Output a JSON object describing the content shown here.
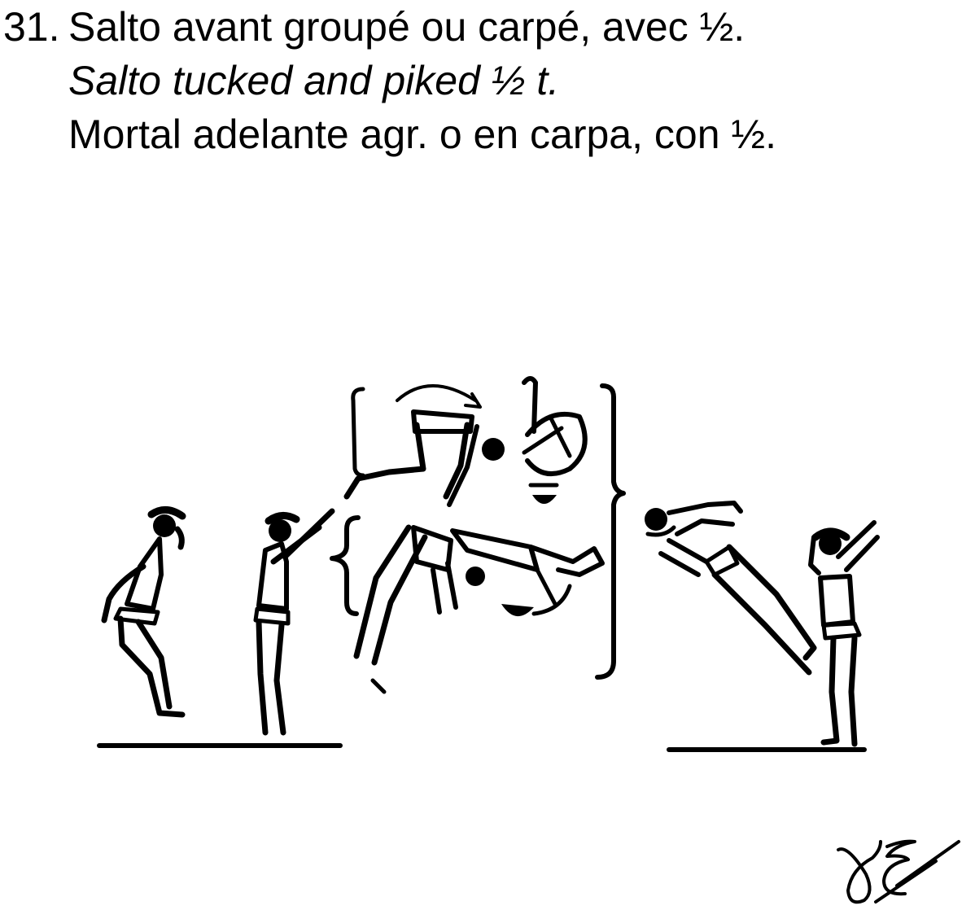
{
  "element": {
    "number": "31.",
    "title_fr": "Salto avant groupé ou carpé, avec ½.",
    "title_en": "Salto tucked and piked ½ t.",
    "title_es": "Mortal adelante agr. o en carpa, con ½."
  },
  "figure": {
    "ink_color": "#000000",
    "background": "#ffffff",
    "figures": [
      "standing-gymnast",
      "takeoff-gymnast",
      "tucked-salto-gymnast",
      "piked-salto-gymnast",
      "rotation-arrow",
      "landing-dive-gymnast",
      "landing-gymnast"
    ],
    "signature_initials": "JE"
  }
}
